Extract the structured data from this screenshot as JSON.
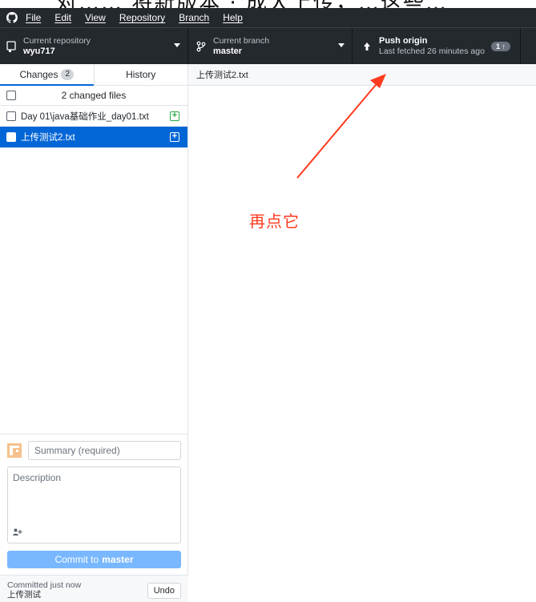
{
  "caption_fragment": "对…… 将新版本 · 成大上传，…这些…",
  "menu": {
    "items": [
      "File",
      "Edit",
      "View",
      "Repository",
      "Branch",
      "Help"
    ]
  },
  "toolbar": {
    "repo": {
      "label": "Current repository",
      "value": "wyu717"
    },
    "branch": {
      "label": "Current branch",
      "value": "master"
    },
    "push": {
      "label": "Push origin",
      "sub": "Last fetched 26 minutes ago",
      "badge": "1 ↑"
    }
  },
  "tabs": {
    "changes": "Changes",
    "changes_count": "2",
    "history": "History"
  },
  "changes": {
    "header": "2 changed files",
    "files": [
      {
        "name": "Day 01\\java基础作业_day01.txt",
        "status": "added",
        "selected": false
      },
      {
        "name": "上传测试2.txt",
        "status": "added",
        "selected": true
      }
    ]
  },
  "commit": {
    "summary_placeholder": "Summary (required)",
    "description_placeholder": "Description",
    "button_prefix": "Commit to",
    "button_branch": "master"
  },
  "last_commit": {
    "label": "Committed just now",
    "message": "上传测试",
    "undo": "Undo"
  },
  "diff": {
    "filename": "上传测试2.txt"
  },
  "annotation": {
    "text": "再点它",
    "color": "#ff3b1f"
  },
  "colors": {
    "toolbar_bg": "#24292e",
    "accent": "#0366d6",
    "commit_button": "#79b8ff",
    "added": "#28a745"
  }
}
